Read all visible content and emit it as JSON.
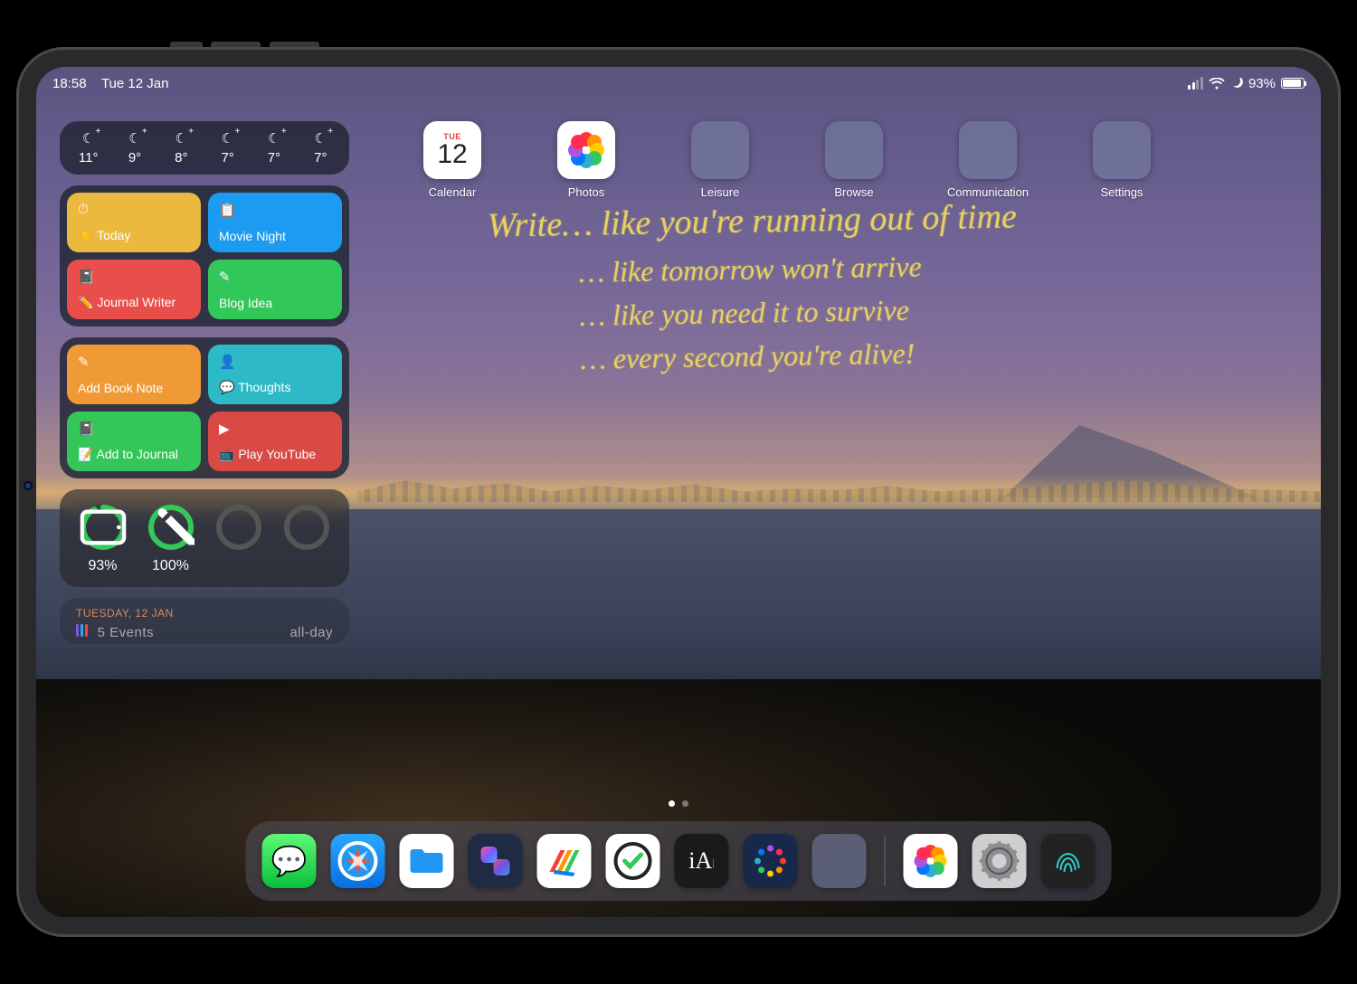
{
  "status": {
    "time": "18:58",
    "date": "Tue 12 Jan",
    "battery_pct": "93%"
  },
  "weather": [
    {
      "icon": "☾",
      "temp": "11°"
    },
    {
      "icon": "☾",
      "temp": "9°"
    },
    {
      "icon": "☾",
      "temp": "8°"
    },
    {
      "icon": "☾",
      "temp": "7°"
    },
    {
      "icon": "☾",
      "temp": "7°"
    },
    {
      "icon": "☾",
      "temp": "7°"
    }
  ],
  "shortcuts_a": [
    {
      "label": "Today",
      "icon": "⏱",
      "color": "sc-yellow",
      "subicon": "☀️"
    },
    {
      "label": "Movie Night",
      "icon": "📋",
      "color": "sc-blue"
    },
    {
      "label": "Journal Writer",
      "icon": "📓",
      "color": "sc-red",
      "subicon": "✏️"
    },
    {
      "label": "Blog Idea",
      "icon": "✎",
      "color": "sc-green"
    }
  ],
  "shortcuts_b": [
    {
      "label": "Add Book Note",
      "icon": "✎",
      "color": "sc-orange"
    },
    {
      "label": "Thoughts",
      "icon": "👤",
      "color": "sc-teal",
      "subicon": "💬"
    },
    {
      "label": "Add to Journal",
      "icon": "📓",
      "color": "sc-green2",
      "subicon": "📝"
    },
    {
      "label": "Play YouTube",
      "icon": "▶",
      "color": "sc-darkred",
      "subicon": "📺"
    }
  ],
  "batteries": {
    "ipad": {
      "pct": "93%",
      "value": 93,
      "icon": "▢",
      "charging": false
    },
    "pencil": {
      "pct": "100%",
      "value": 100,
      "icon": "✎",
      "charging": true
    }
  },
  "calendar_preview": {
    "date_label": "TUESDAY, 12 JAN",
    "events": "5 Events",
    "tag": "all-day"
  },
  "apps": {
    "calendar": {
      "label": "Calendar",
      "day": "TUE",
      "num": "12"
    },
    "photos": {
      "label": "Photos"
    },
    "folders": [
      {
        "label": "Leisure"
      },
      {
        "label": "Browse"
      },
      {
        "label": "Communication"
      },
      {
        "label": "Settings"
      }
    ]
  },
  "handwriting": [
    "Write… like you're running out of time",
    "… like tomorrow won't arrive",
    "… like you need it to survive",
    "… every second you're alive!"
  ],
  "dock": [
    {
      "name": "messages",
      "bg": "linear-gradient(#5ff777,#09c03c)",
      "glyph": "💬"
    },
    {
      "name": "safari",
      "bg": "linear-gradient(#29a9ff,#0a6ee0)",
      "glyph": "compass"
    },
    {
      "name": "files",
      "bg": "#ffffff",
      "glyph": "folder"
    },
    {
      "name": "shortcuts",
      "bg": "#1f2a44",
      "glyph": "shortcuts"
    },
    {
      "name": "agenda",
      "bg": "#ffffff",
      "glyph": "stripes"
    },
    {
      "name": "omnifocus",
      "bg": "#ffffff",
      "glyph": "check"
    },
    {
      "name": "iawriter",
      "bg": "#1a1a1a",
      "glyph": "iA"
    },
    {
      "name": "drafts",
      "bg": "#18284a",
      "glyph": "circles"
    },
    {
      "name": "folder-dock",
      "bg": "folder",
      "glyph": ""
    },
    {
      "name": "photos-dock",
      "bg": "#ffffff",
      "glyph": "flower"
    },
    {
      "name": "settings-dock",
      "bg": "#cfcfcf",
      "glyph": "gear"
    },
    {
      "name": "touchid",
      "bg": "#222222",
      "glyph": "finger"
    }
  ]
}
